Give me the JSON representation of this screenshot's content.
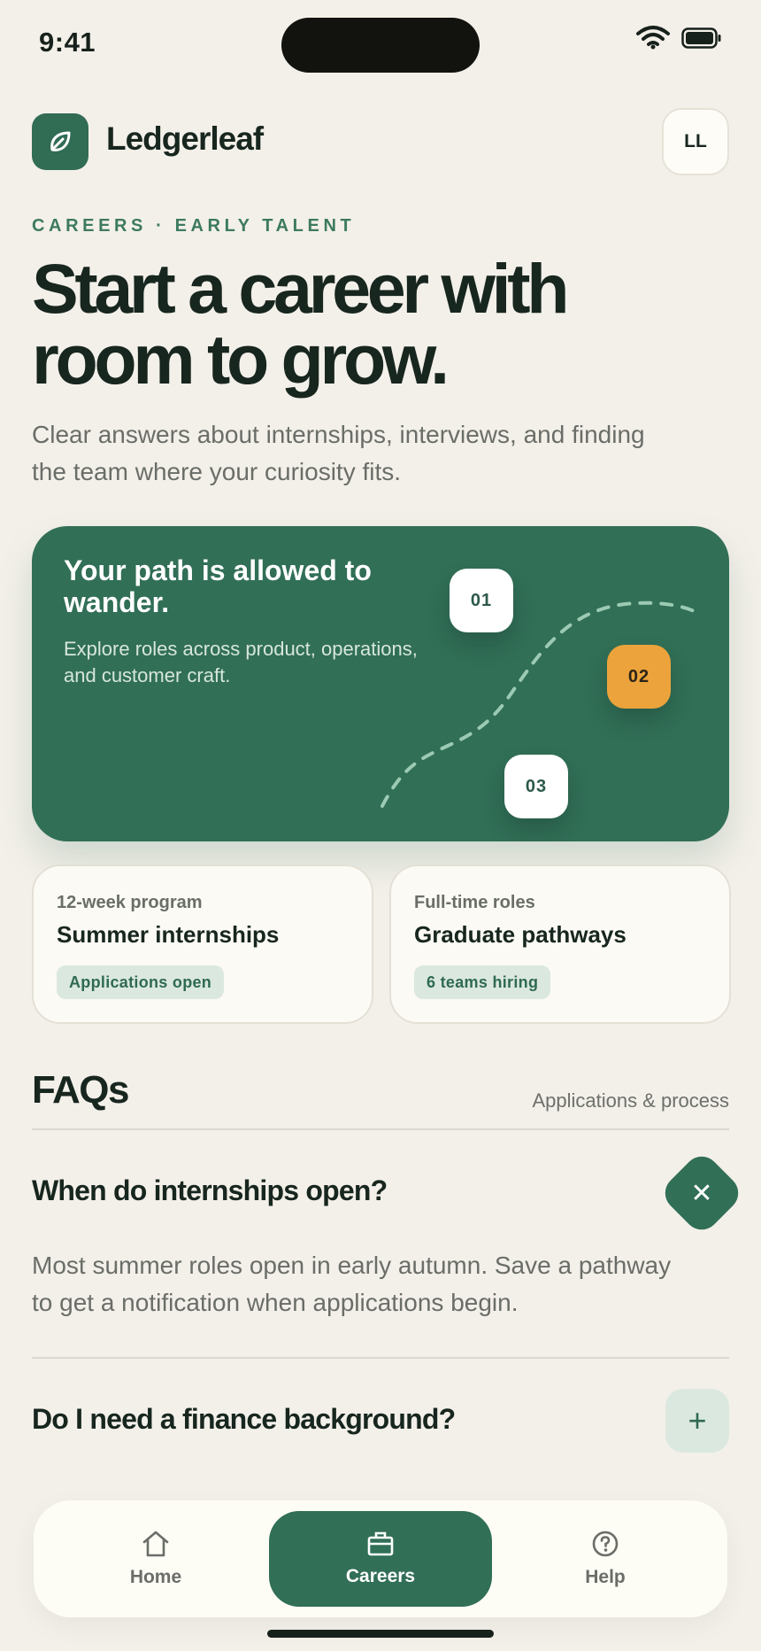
{
  "status_bar": {
    "time": "9:41"
  },
  "header": {
    "brand": "Ledgerleaf",
    "avatar_initials": "LL"
  },
  "intro": {
    "eyebrow": "CAREERS · EARLY TALENT",
    "headline_line1": "Start a career with",
    "headline_line2": "room to grow.",
    "subtitle": "Clear answers about internships, interviews, and finding the team where your curiosity fits."
  },
  "hero": {
    "title": "Your path is allowed to wander.",
    "text": "Explore roles across product, operations, and customer craft.",
    "steps": [
      "01",
      "02",
      "03"
    ]
  },
  "programs": [
    {
      "kicker": "12-week program",
      "title": "Summer internships",
      "badge": "Applications open"
    },
    {
      "kicker": "Full-time roles",
      "title": "Graduate pathways",
      "badge": "6 teams hiring"
    }
  ],
  "faq": {
    "heading": "FAQs",
    "subheading": "Applications & process",
    "items": [
      {
        "question": "When do internships open?",
        "answer": "Most summer roles open in early autumn. Save a pathway to get a notification when applications begin.",
        "expanded": true
      },
      {
        "question": "Do I need a finance background?",
        "expanded": false
      }
    ]
  },
  "tabs": [
    {
      "label": "Home",
      "icon": "house-icon",
      "active": false
    },
    {
      "label": "Careers",
      "icon": "briefcase-icon",
      "active": true
    },
    {
      "label": "Help",
      "icon": "help-circle-icon",
      "active": false
    }
  ],
  "colors": {
    "brand_green": "#316f57",
    "accent_amber": "#eca33c",
    "background": "#f3f0e9"
  }
}
